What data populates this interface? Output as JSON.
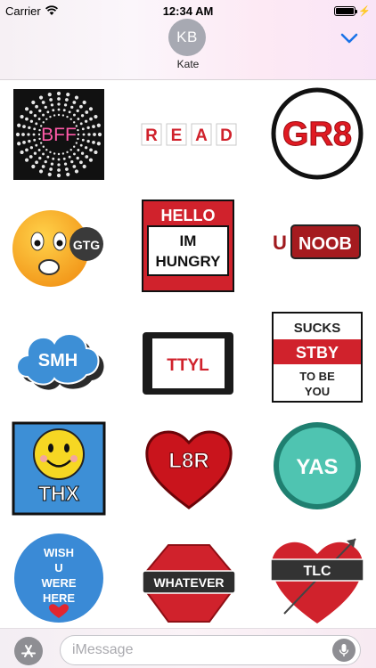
{
  "status_bar": {
    "carrier": "Carrier",
    "time": "12:34 AM"
  },
  "header": {
    "avatar_initials": "KB",
    "contact_name": "Kate"
  },
  "stickers": {
    "bff": "BFF",
    "read": [
      "R",
      "E",
      "A",
      "D"
    ],
    "gr8": "GR8",
    "gtg": "GTG",
    "hello": {
      "line1": "HELLO",
      "line2": "IM",
      "line3": "HUNGRY"
    },
    "unoob": {
      "u": "U",
      "noob": "NOOB"
    },
    "smh": "SMH",
    "ttyl": "TTYL",
    "sucks": {
      "line1": "SUCKS",
      "line2": "STBY",
      "line3": "TO BE",
      "line4": "YOU"
    },
    "thx": "THX",
    "l8r": "L8R",
    "yas": "YAS",
    "wish": [
      "WISH",
      "U",
      "WERE",
      "HERE"
    ],
    "whatever": "WHATEVER",
    "tlc": "TLC"
  },
  "input": {
    "placeholder": "iMessage"
  },
  "colors": {
    "accent": "#1a73e8",
    "sticker_red": "#d0222c",
    "avatar": "#a7a9b2"
  }
}
